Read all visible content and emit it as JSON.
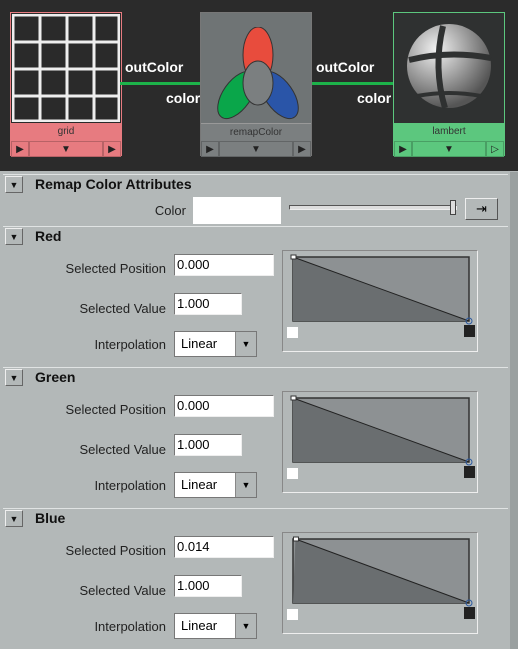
{
  "nodes": [
    {
      "name": "grid",
      "color": "#e77b80"
    },
    {
      "name": "remapColor",
      "color": "#7b7f80"
    },
    {
      "name": "lambert",
      "color": "#5cc77e"
    }
  ],
  "connections": [
    {
      "out": "outColor",
      "in": "color"
    },
    {
      "out": "outColor",
      "in": "color"
    }
  ],
  "remap": {
    "title": "Remap Color Attributes",
    "color_label": "Color",
    "color_value": "#ffffff",
    "slider_value": 1.0
  },
  "channels": [
    {
      "title": "Red",
      "position_label": "Selected Position",
      "position": "0.000",
      "value_label": "Selected Value",
      "value": "1.000",
      "interp_label": "Interpolation",
      "interp": "Linear",
      "curve": [
        [
          0,
          1
        ],
        [
          1,
          0
        ]
      ]
    },
    {
      "title": "Green",
      "position_label": "Selected Position",
      "position": "0.000",
      "value_label": "Selected Value",
      "value": "1.000",
      "interp_label": "Interpolation",
      "interp": "Linear",
      "curve": [
        [
          0,
          1
        ],
        [
          1,
          0
        ]
      ]
    },
    {
      "title": "Blue",
      "position_label": "Selected Position",
      "position": "0.014",
      "value_label": "Selected Value",
      "value": "1.000",
      "interp_label": "Interpolation",
      "interp": "Linear",
      "curve": [
        [
          0.014,
          1
        ],
        [
          1,
          0
        ]
      ]
    }
  ]
}
